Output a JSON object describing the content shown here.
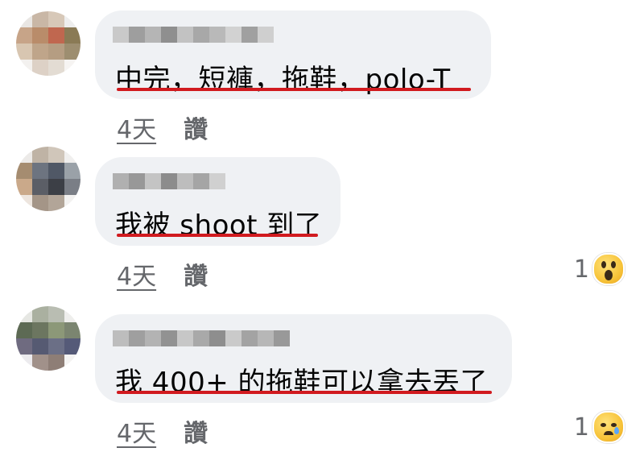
{
  "comments": [
    {
      "text": "中完，短褲，拖鞋，polo-T",
      "time": "4天",
      "like_label": "讚",
      "reaction_count": ""
    },
    {
      "text": "我被 shoot 到了",
      "time": "4天",
      "like_label": "讚",
      "reaction_count": "1",
      "reaction_icon": "wow-emoji-icon"
    },
    {
      "text": "我 400+ 的拖鞋可以拿去丟了",
      "time": "4天",
      "like_label": "讚",
      "reaction_count": "1",
      "reaction_icon": "sad-emoji-icon"
    }
  ],
  "colors": {
    "bubble": "#eff1f4",
    "highlight_underline": "#d11a1f",
    "meta_text": "#65676b",
    "body_text": "#050505"
  }
}
